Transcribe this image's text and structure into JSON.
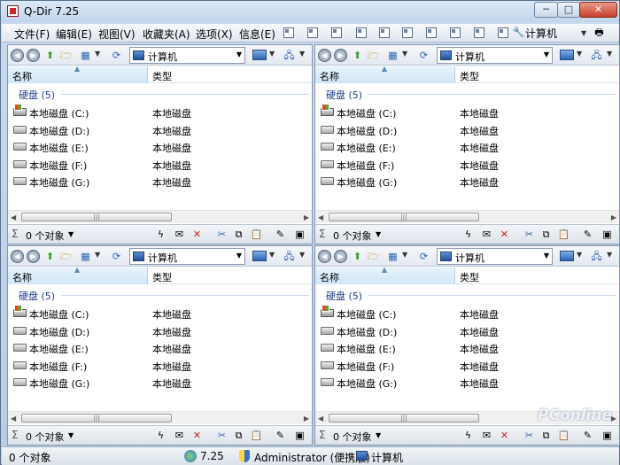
{
  "window": {
    "title": "Q-Dir 7.25",
    "min_glyph": "─",
    "max_glyph": "□",
    "close_glyph": "✕"
  },
  "menu": {
    "items": [
      "文件(F)",
      "编辑(E)",
      "视图(V)",
      "收藏夹(A)",
      "选项(X)",
      "信息(E)"
    ],
    "computer": "计算机"
  },
  "pane": {
    "address": "计算机",
    "col_name": "名称",
    "col_type": "类型",
    "group": "硬盘 (5)",
    "drives": [
      {
        "name": "本地磁盘 (C:)",
        "type": "本地磁盘"
      },
      {
        "name": "本地磁盘 (D:)",
        "type": "本地磁盘"
      },
      {
        "name": "本地磁盘 (E:)",
        "type": "本地磁盘"
      },
      {
        "name": "本地磁盘 (F:)",
        "type": "本地磁盘"
      },
      {
        "name": "本地磁盘 (G:)",
        "type": "本地磁盘"
      }
    ],
    "status_count": "0 个对象"
  },
  "status": {
    "count": "0 个对象",
    "version": "7.25",
    "user": "Administrator (便携版)",
    "location": "计算机"
  },
  "watermark": "PConline"
}
